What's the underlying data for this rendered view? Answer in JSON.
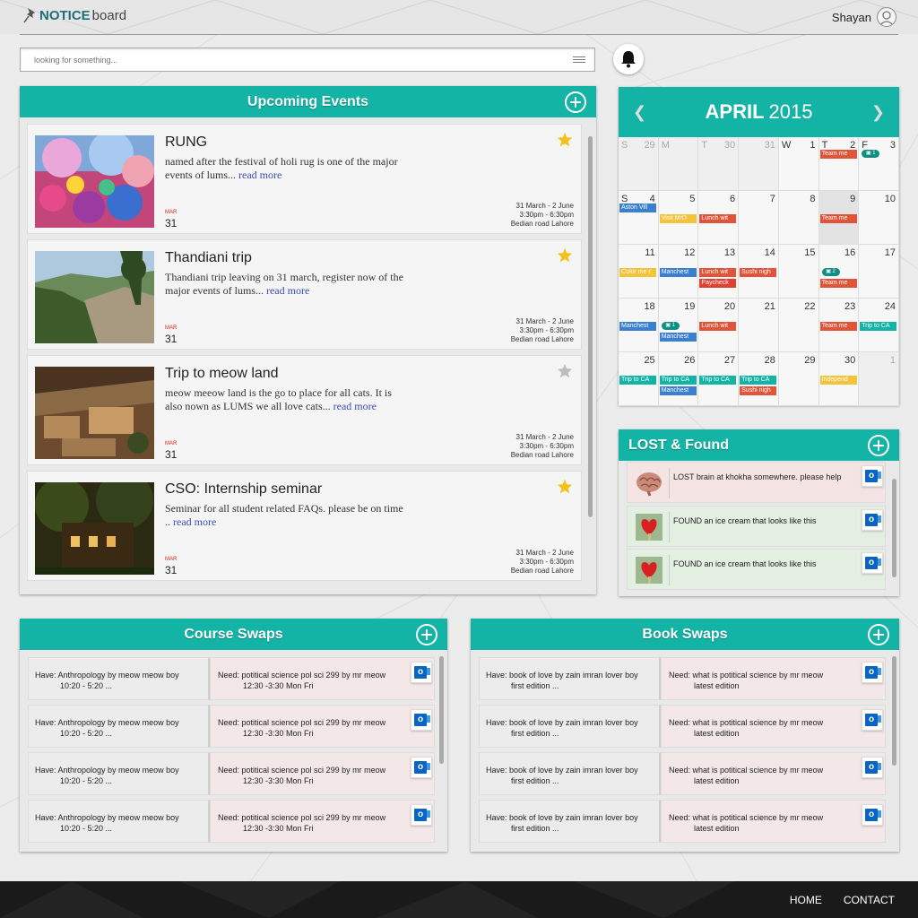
{
  "header": {
    "logo_bold": "NOTICE",
    "logo_light": "board",
    "user_name": "Shayan"
  },
  "search": {
    "placeholder": "looking for something..."
  },
  "events": {
    "title": "Upcoming Events",
    "items": [
      {
        "title": "RUNG",
        "desc": "named after the festival of holi rug is one of the major events of lums...",
        "read_more": "read more",
        "month": "MAR",
        "day": "31",
        "dates": "31 March - 2 June",
        "time": "3:30pm - 6:30pm",
        "location": "Bedian road Lahore",
        "starred": true
      },
      {
        "title": "Thandiani trip",
        "desc": "Thandiani trip leaving on 31 march, register now of the major events of lums...",
        "read_more": "read more",
        "month": "MAR",
        "day": "31",
        "dates": "31 March - 2 June",
        "time": "3:30pm - 6:30pm",
        "location": "Bedian road Lahore",
        "starred": true
      },
      {
        "title": "Trip to meow land",
        "desc": "meow meeow land is the go to place for all cats. It is also nown as LUMS we all love cats...",
        "read_more": "read more",
        "month": "MAR",
        "day": "31",
        "dates": "31 March - 2 June",
        "time": "3:30pm - 6:30pm",
        "location": "Bedian road Lahore",
        "starred": false
      },
      {
        "title": "CSO: Internship seminar",
        "desc": "Seminar for all student related FAQs. please be on time ..",
        "read_more": "read more",
        "month": "MAR",
        "day": "31",
        "dates": "31 March - 2 June",
        "time": "3:30pm - 6:30pm",
        "location": "Bedian road Lahore",
        "starred": true
      }
    ]
  },
  "calendar": {
    "month": "APRIL",
    "year": "2015",
    "weeks": [
      [
        {
          "wd": "S",
          "d": "29",
          "out": true
        },
        {
          "wd": "M",
          "d": "",
          "out": true
        },
        {
          "wd": "T",
          "d": "30",
          "out": true
        },
        {
          "wd": "",
          "d": "31",
          "out": true
        },
        {
          "wd": "W",
          "d": "1"
        },
        {
          "wd": "T",
          "d": "2"
        },
        {
          "wd": "F",
          "d": "3"
        }
      ],
      [
        {
          "wd": "S",
          "d": "4"
        },
        {
          "d": "5"
        },
        {
          "d": "6"
        },
        {
          "d": "7"
        },
        {
          "d": "8"
        },
        {
          "d": "9",
          "today": true
        },
        {
          "d": "10"
        }
      ],
      [
        {
          "d": "11"
        },
        {
          "d": "12"
        },
        {
          "d": "13"
        },
        {
          "d": "14"
        },
        {
          "d": "15"
        },
        {
          "d": "16"
        },
        {
          "d": "17"
        }
      ],
      [
        {
          "d": "18"
        },
        {
          "d": "19"
        },
        {
          "d": "20"
        },
        {
          "d": "21"
        },
        {
          "d": "22"
        },
        {
          "d": "23"
        },
        {
          "d": "24"
        }
      ],
      [
        {
          "d": "25"
        },
        {
          "d": "26"
        },
        {
          "d": "27"
        },
        {
          "d": "28"
        },
        {
          "d": "29"
        },
        {
          "d": "30"
        },
        {
          "d": "1",
          "out": true
        }
      ]
    ],
    "events": [
      {
        "cell": [
          0,
          5
        ],
        "row": 0,
        "text": "Team me",
        "color": "#e0553a"
      },
      {
        "cell": [
          0,
          6
        ],
        "row": 0,
        "pill": "1"
      },
      {
        "cell": [
          1,
          0
        ],
        "row": 0,
        "text": "Aston Vill",
        "color": "#3a7fd0"
      },
      {
        "cell": [
          1,
          1
        ],
        "row": 1,
        "text": "Visit MrD",
        "color": "#f3c33a"
      },
      {
        "cell": [
          1,
          2
        ],
        "row": 1,
        "text": "Lunch wit",
        "color": "#e0553a"
      },
      {
        "cell": [
          1,
          5
        ],
        "row": 1,
        "text": "Team me",
        "color": "#e0553a"
      },
      {
        "cell": [
          2,
          0
        ],
        "row": 1,
        "text": "Color me r",
        "color": "#f3c33a"
      },
      {
        "cell": [
          2,
          1
        ],
        "row": 1,
        "text": "Manchest",
        "color": "#3a7fd0"
      },
      {
        "cell": [
          2,
          2
        ],
        "row": 1,
        "text": "Lunch wit",
        "color": "#e0553a"
      },
      {
        "cell": [
          2,
          2
        ],
        "row": 2,
        "text": "Paycheck",
        "color": "#e04030"
      },
      {
        "cell": [
          2,
          3
        ],
        "row": 1,
        "text": "Sushi nigh",
        "color": "#e0553a"
      },
      {
        "cell": [
          2,
          5
        ],
        "row": 1,
        "pill": "2"
      },
      {
        "cell": [
          2,
          5
        ],
        "row": 2,
        "text": "Team me",
        "color": "#e0553a"
      },
      {
        "cell": [
          3,
          0
        ],
        "row": 1,
        "text": "Manchest",
        "color": "#3a7fd0"
      },
      {
        "cell": [
          3,
          1
        ],
        "row": 1,
        "pill": "1"
      },
      {
        "cell": [
          3,
          1
        ],
        "row": 2,
        "text": "Manchest",
        "color": "#3a7fd0"
      },
      {
        "cell": [
          3,
          2
        ],
        "row": 1,
        "text": "Lunch wit",
        "color": "#e0553a"
      },
      {
        "cell": [
          3,
          5
        ],
        "row": 1,
        "text": "Team me",
        "color": "#e0553a"
      },
      {
        "cell": [
          3,
          6
        ],
        "row": 1,
        "text": "Trip to CA",
        "color": "#13b4a6"
      },
      {
        "cell": [
          4,
          0
        ],
        "row": 1,
        "text": "Trip to CA",
        "color": "#13b4a6"
      },
      {
        "cell": [
          4,
          1
        ],
        "row": 1,
        "text": "Trip to CA",
        "color": "#13b4a6"
      },
      {
        "cell": [
          4,
          1
        ],
        "row": 2,
        "text": "Manchest",
        "color": "#3a7fd0"
      },
      {
        "cell": [
          4,
          2
        ],
        "row": 1,
        "text": "Trip to CA",
        "color": "#13b4a6"
      },
      {
        "cell": [
          4,
          3
        ],
        "row": 1,
        "text": "Trip to CA",
        "color": "#13b4a6"
      },
      {
        "cell": [
          4,
          3
        ],
        "row": 2,
        "text": "Sushi nigh",
        "color": "#e0553a"
      },
      {
        "cell": [
          4,
          5
        ],
        "row": 1,
        "text": "Independ",
        "color": "#f3c33a"
      }
    ]
  },
  "lost_found": {
    "title": "LOST & Found",
    "items": [
      {
        "text": "LOST brain at khokha somewhere. please help",
        "kind": "lost",
        "icon": "brain-icon"
      },
      {
        "text": "FOUND an ice cream that looks like this",
        "kind": "found",
        "icon": "ice-cream-icon"
      },
      {
        "text": "FOUND an ice cream that looks like this",
        "kind": "found",
        "icon": "ice-cream-icon"
      }
    ]
  },
  "course_swaps": {
    "title": "Course Swaps",
    "items": [
      {
        "have1": "Have: Anthropology by meow meow boy",
        "have2": "10:20 - 5:20 ...",
        "need1": "Need: potitical science pol sci 299 by mr meow",
        "need2": "12:30 -3:30 Mon Fri"
      },
      {
        "have1": "Have: Anthropology by meow meow boy",
        "have2": "10:20 - 5:20 ...",
        "need1": "Need: potitical science pol sci 299 by mr meow",
        "need2": "12:30 -3:30 Mon Fri"
      },
      {
        "have1": "Have: Anthropology by meow meow boy",
        "have2": "10:20 - 5:20 ...",
        "need1": "Need: potitical science pol sci 299 by mr meow",
        "need2": "12:30 -3:30 Mon Fri"
      },
      {
        "have1": "Have: Anthropology by meow meow boy",
        "have2": "10:20 - 5:20 ...",
        "need1": "Need: potitical science pol sci 299 by mr meow",
        "need2": "12:30 -3:30 Mon Fri"
      }
    ]
  },
  "book_swaps": {
    "title": "Book Swaps",
    "items": [
      {
        "have1": "Have: book of love by zain imran lover boy",
        "have2": "first edition ...",
        "need1": "Need: what is potitical science by mr meow",
        "need2": "latest edition"
      },
      {
        "have1": "Have: book of love by zain imran lover boy",
        "have2": "first edition ...",
        "need1": "Need: what is potitical science by mr meow",
        "need2": "latest edition"
      },
      {
        "have1": "Have: book of love by zain imran lover boy",
        "have2": "first edition ...",
        "need1": "Need: what is potitical science by mr meow",
        "need2": "latest edition"
      },
      {
        "have1": "Have: book of love by zain imran lover boy",
        "have2": "first edition ...",
        "need1": "Need: what is potitical science by mr meow",
        "need2": "latest edition"
      }
    ]
  },
  "footer": {
    "home": "HOME",
    "contact": "CONTACT"
  },
  "colors": {
    "accent": "#13b4a6",
    "star_on": "#f2c21a",
    "star_off": "#bdbdbd",
    "lost_bg": "#f4e4e4",
    "found_bg": "#e3efe1"
  }
}
